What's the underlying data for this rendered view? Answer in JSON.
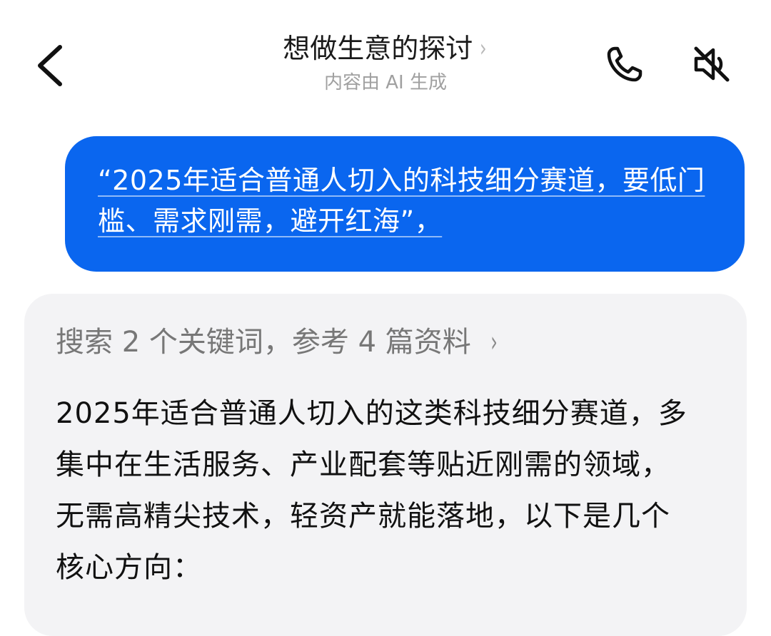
{
  "header": {
    "title": "想做生意的探讨",
    "title_chevron": "›",
    "subtitle": "内容由 AI 生成",
    "back_icon": "chevron-left-icon",
    "call_icon": "phone-icon",
    "mute_icon": "speaker-muted-icon"
  },
  "user_message": {
    "text": "“2025年适合普通人切入的科技细分赛道，要低门槛、需求刚需，避开红海”，",
    "bubble_color": "#0a66ef"
  },
  "ai_message": {
    "sources_label": "搜索 2 个关键词，参考 4 篇资料",
    "sources_chevron": "›",
    "answer": "2025年适合普通人切入的这类科技细分赛道，多集中在生活服务、产业配套等贴近刚需的领域，无需高精尖技术，轻资产就能落地，以下是几个核心方向："
  }
}
